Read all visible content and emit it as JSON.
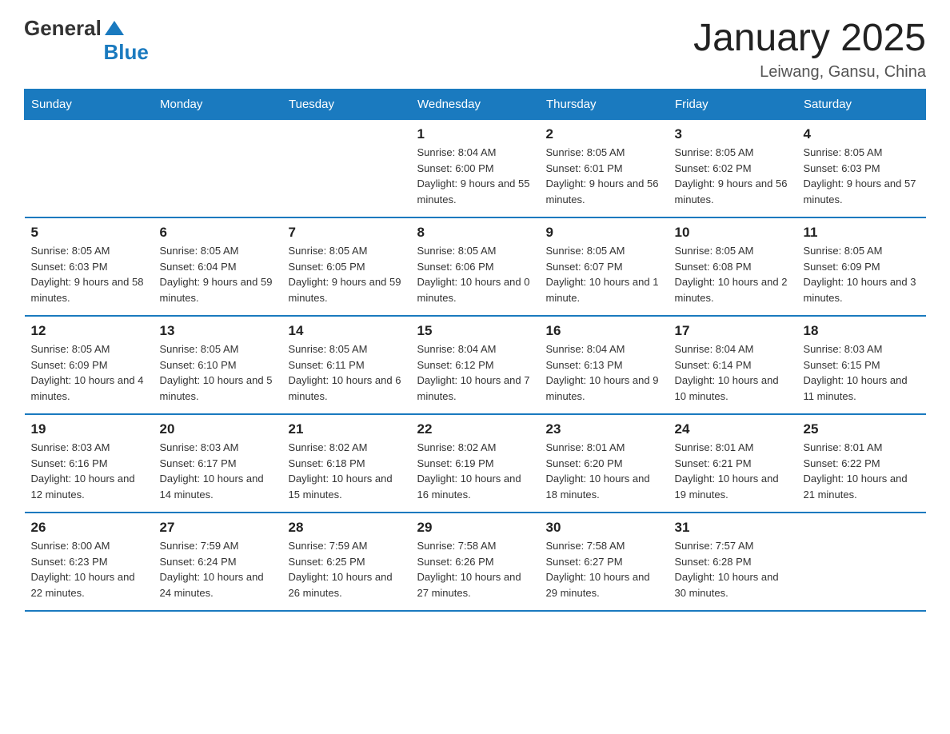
{
  "logo": {
    "text_general": "General",
    "text_blue": "Blue"
  },
  "title": "January 2025",
  "subtitle": "Leiwang, Gansu, China",
  "days_of_week": [
    "Sunday",
    "Monday",
    "Tuesday",
    "Wednesday",
    "Thursday",
    "Friday",
    "Saturday"
  ],
  "weeks": [
    [
      {
        "day": "",
        "info": ""
      },
      {
        "day": "",
        "info": ""
      },
      {
        "day": "",
        "info": ""
      },
      {
        "day": "1",
        "info": "Sunrise: 8:04 AM\nSunset: 6:00 PM\nDaylight: 9 hours and 55 minutes."
      },
      {
        "day": "2",
        "info": "Sunrise: 8:05 AM\nSunset: 6:01 PM\nDaylight: 9 hours and 56 minutes."
      },
      {
        "day": "3",
        "info": "Sunrise: 8:05 AM\nSunset: 6:02 PM\nDaylight: 9 hours and 56 minutes."
      },
      {
        "day": "4",
        "info": "Sunrise: 8:05 AM\nSunset: 6:03 PM\nDaylight: 9 hours and 57 minutes."
      }
    ],
    [
      {
        "day": "5",
        "info": "Sunrise: 8:05 AM\nSunset: 6:03 PM\nDaylight: 9 hours and 58 minutes."
      },
      {
        "day": "6",
        "info": "Sunrise: 8:05 AM\nSunset: 6:04 PM\nDaylight: 9 hours and 59 minutes."
      },
      {
        "day": "7",
        "info": "Sunrise: 8:05 AM\nSunset: 6:05 PM\nDaylight: 9 hours and 59 minutes."
      },
      {
        "day": "8",
        "info": "Sunrise: 8:05 AM\nSunset: 6:06 PM\nDaylight: 10 hours and 0 minutes."
      },
      {
        "day": "9",
        "info": "Sunrise: 8:05 AM\nSunset: 6:07 PM\nDaylight: 10 hours and 1 minute."
      },
      {
        "day": "10",
        "info": "Sunrise: 8:05 AM\nSunset: 6:08 PM\nDaylight: 10 hours and 2 minutes."
      },
      {
        "day": "11",
        "info": "Sunrise: 8:05 AM\nSunset: 6:09 PM\nDaylight: 10 hours and 3 minutes."
      }
    ],
    [
      {
        "day": "12",
        "info": "Sunrise: 8:05 AM\nSunset: 6:09 PM\nDaylight: 10 hours and 4 minutes."
      },
      {
        "day": "13",
        "info": "Sunrise: 8:05 AM\nSunset: 6:10 PM\nDaylight: 10 hours and 5 minutes."
      },
      {
        "day": "14",
        "info": "Sunrise: 8:05 AM\nSunset: 6:11 PM\nDaylight: 10 hours and 6 minutes."
      },
      {
        "day": "15",
        "info": "Sunrise: 8:04 AM\nSunset: 6:12 PM\nDaylight: 10 hours and 7 minutes."
      },
      {
        "day": "16",
        "info": "Sunrise: 8:04 AM\nSunset: 6:13 PM\nDaylight: 10 hours and 9 minutes."
      },
      {
        "day": "17",
        "info": "Sunrise: 8:04 AM\nSunset: 6:14 PM\nDaylight: 10 hours and 10 minutes."
      },
      {
        "day": "18",
        "info": "Sunrise: 8:03 AM\nSunset: 6:15 PM\nDaylight: 10 hours and 11 minutes."
      }
    ],
    [
      {
        "day": "19",
        "info": "Sunrise: 8:03 AM\nSunset: 6:16 PM\nDaylight: 10 hours and 12 minutes."
      },
      {
        "day": "20",
        "info": "Sunrise: 8:03 AM\nSunset: 6:17 PM\nDaylight: 10 hours and 14 minutes."
      },
      {
        "day": "21",
        "info": "Sunrise: 8:02 AM\nSunset: 6:18 PM\nDaylight: 10 hours and 15 minutes."
      },
      {
        "day": "22",
        "info": "Sunrise: 8:02 AM\nSunset: 6:19 PM\nDaylight: 10 hours and 16 minutes."
      },
      {
        "day": "23",
        "info": "Sunrise: 8:01 AM\nSunset: 6:20 PM\nDaylight: 10 hours and 18 minutes."
      },
      {
        "day": "24",
        "info": "Sunrise: 8:01 AM\nSunset: 6:21 PM\nDaylight: 10 hours and 19 minutes."
      },
      {
        "day": "25",
        "info": "Sunrise: 8:01 AM\nSunset: 6:22 PM\nDaylight: 10 hours and 21 minutes."
      }
    ],
    [
      {
        "day": "26",
        "info": "Sunrise: 8:00 AM\nSunset: 6:23 PM\nDaylight: 10 hours and 22 minutes."
      },
      {
        "day": "27",
        "info": "Sunrise: 7:59 AM\nSunset: 6:24 PM\nDaylight: 10 hours and 24 minutes."
      },
      {
        "day": "28",
        "info": "Sunrise: 7:59 AM\nSunset: 6:25 PM\nDaylight: 10 hours and 26 minutes."
      },
      {
        "day": "29",
        "info": "Sunrise: 7:58 AM\nSunset: 6:26 PM\nDaylight: 10 hours and 27 minutes."
      },
      {
        "day": "30",
        "info": "Sunrise: 7:58 AM\nSunset: 6:27 PM\nDaylight: 10 hours and 29 minutes."
      },
      {
        "day": "31",
        "info": "Sunrise: 7:57 AM\nSunset: 6:28 PM\nDaylight: 10 hours and 30 minutes."
      },
      {
        "day": "",
        "info": ""
      }
    ]
  ]
}
